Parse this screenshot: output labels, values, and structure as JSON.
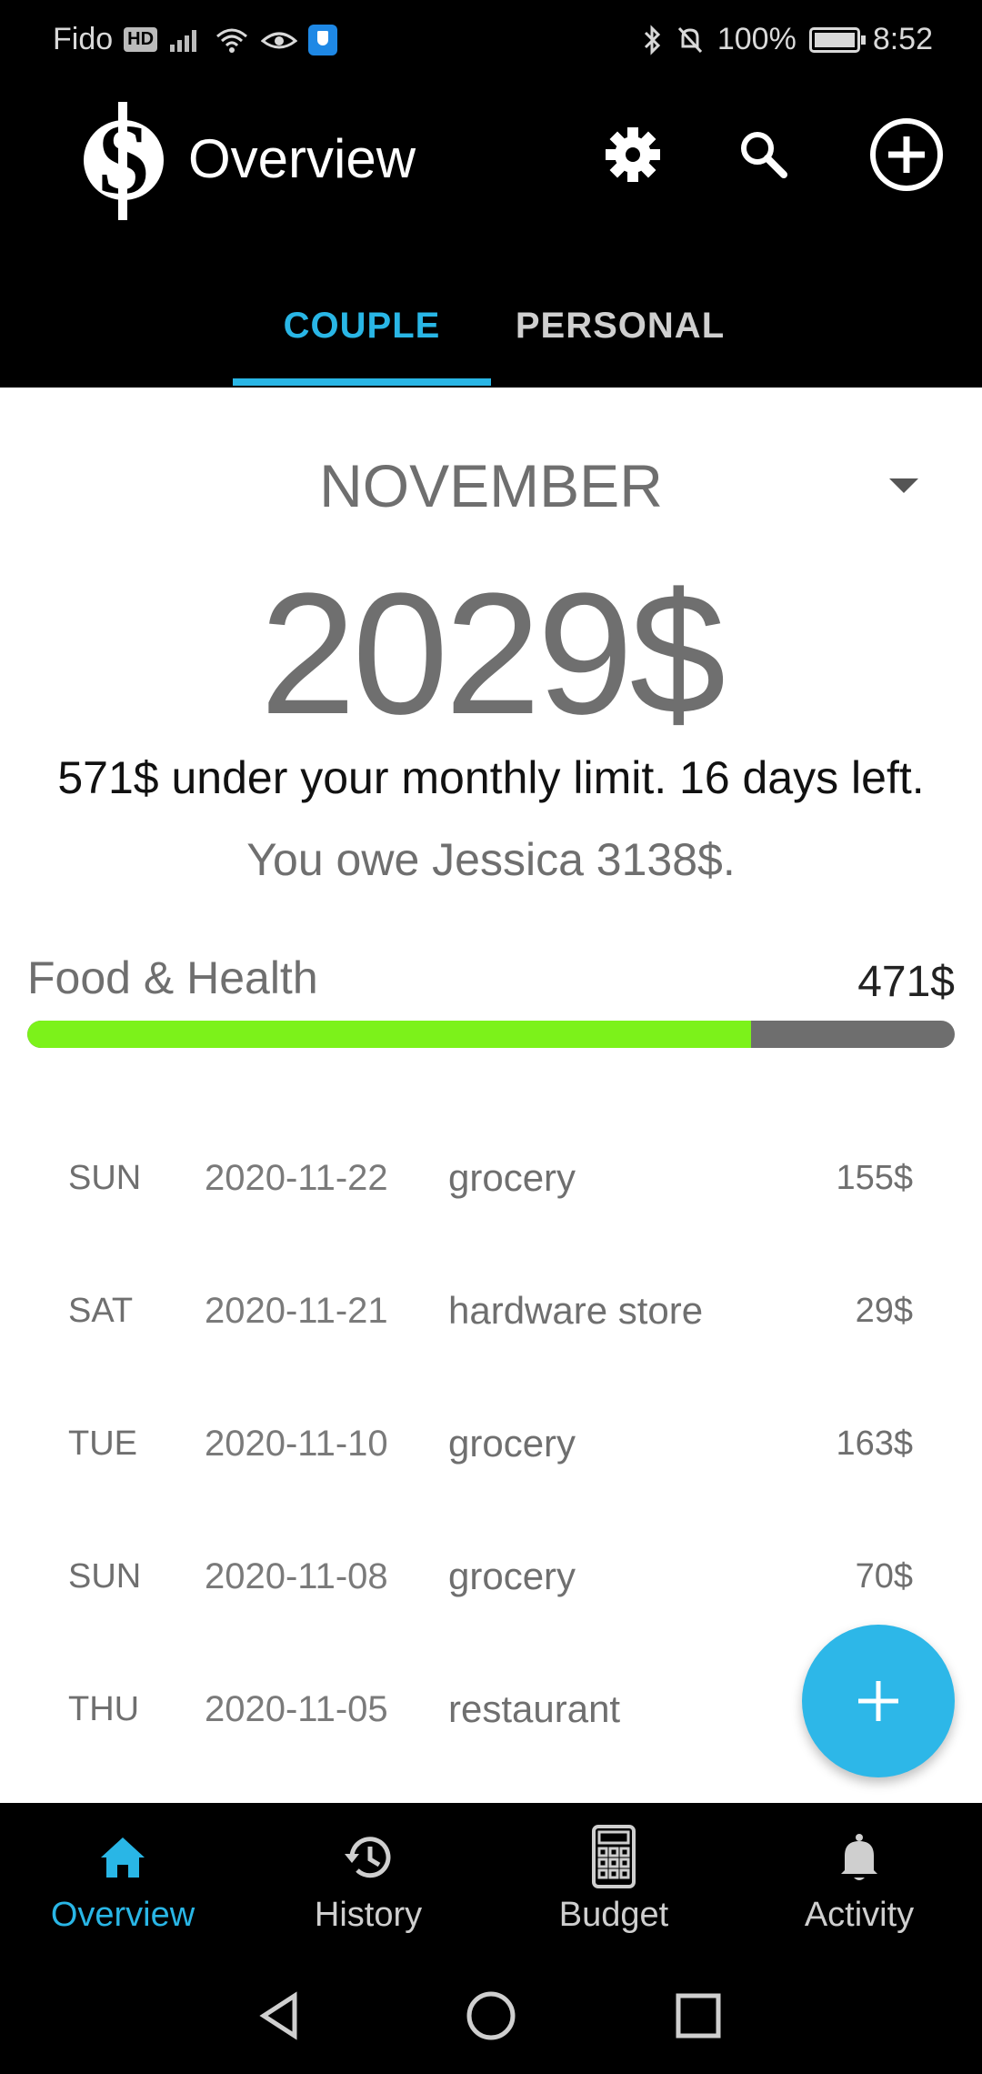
{
  "status_bar": {
    "carrier": "Fido",
    "hd_badge": "HD",
    "battery": "100%",
    "time": "8:52"
  },
  "app_bar": {
    "title": "Overview",
    "icons": [
      "dollar-logo-icon",
      "settings-icon",
      "search-icon",
      "add-circle-icon"
    ]
  },
  "tabs": [
    {
      "label": "COUPLE",
      "active": true
    },
    {
      "label": "PERSONAL",
      "active": false
    }
  ],
  "overview": {
    "month": "NOVEMBER",
    "amount": "2029$",
    "summary": "571$ under your monthly limit. 16 days left.",
    "owe": "You owe Jessica 3138$."
  },
  "category": {
    "name": "Food & Health",
    "amount": "471$",
    "progress_percent": 78,
    "fill_color": "#7cf21a",
    "track_color": "#6e6e6e"
  },
  "transactions": [
    {
      "day": "SUN",
      "date": "2020-11-22",
      "desc": "grocery",
      "amount": "155$"
    },
    {
      "day": "SAT",
      "date": "2020-11-21",
      "desc": "hardware store",
      "amount": "29$"
    },
    {
      "day": "TUE",
      "date": "2020-11-10",
      "desc": "grocery",
      "amount": "163$"
    },
    {
      "day": "SUN",
      "date": "2020-11-08",
      "desc": "grocery",
      "amount": "70$"
    },
    {
      "day": "THU",
      "date": "2020-11-05",
      "desc": "restaurant",
      "amount": ""
    }
  ],
  "bottom_nav": [
    {
      "label": "Overview",
      "icon": "home-icon",
      "active": true
    },
    {
      "label": "History",
      "icon": "history-icon",
      "active": false
    },
    {
      "label": "Budget",
      "icon": "calculator-icon",
      "active": false
    },
    {
      "label": "Activity",
      "icon": "bell-icon",
      "active": false
    }
  ],
  "colors": {
    "accent": "#29b6e6",
    "fab": "#2db7e8"
  }
}
